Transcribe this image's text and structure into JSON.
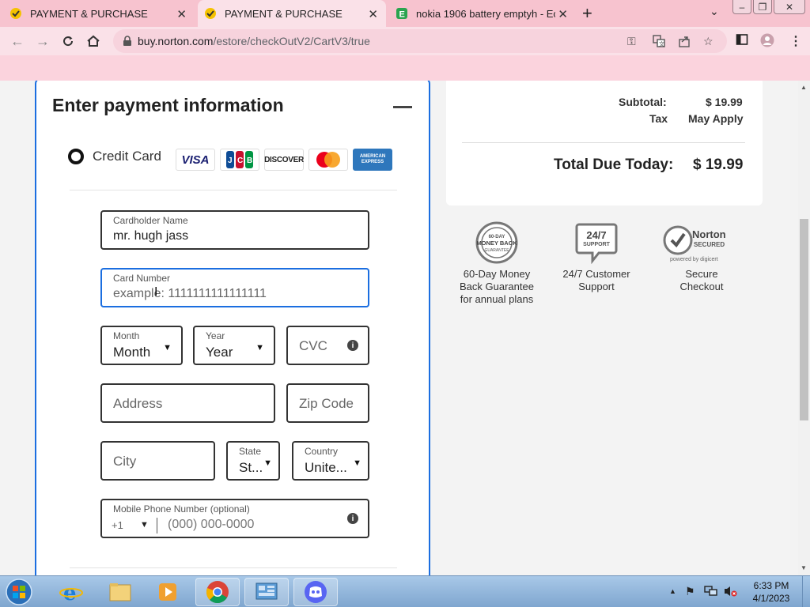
{
  "browser": {
    "tabs": [
      {
        "title": "PAYMENT & PURCHASE",
        "active": false
      },
      {
        "title": "PAYMENT & PURCHASE",
        "active": true
      },
      {
        "title": "nokia 1906 battery emptyh - Eco",
        "active": false
      }
    ],
    "url_host": "buy.norton.com",
    "url_path": "/estore/checkOutV2/CartV3/true"
  },
  "payment": {
    "title": "Enter payment information",
    "method_label": "Credit Card",
    "card_brands": [
      "VISA",
      "JCB",
      "DISCOVER",
      "Mastercard",
      "AMERICAN EXPRESS"
    ],
    "cardholder": {
      "label": "Cardholder Name",
      "value": "mr. hugh jass"
    },
    "card_number": {
      "label": "Card Number",
      "placeholder": "example: 1111111111111111"
    },
    "month": {
      "label": "Month",
      "value": "Month"
    },
    "year": {
      "label": "Year",
      "value": "Year"
    },
    "cvc": {
      "placeholder": "CVC"
    },
    "address": {
      "placeholder": "Address"
    },
    "zip": {
      "placeholder": "Zip Code"
    },
    "city": {
      "placeholder": "City"
    },
    "state": {
      "label": "State",
      "value": "St..."
    },
    "country": {
      "label": "Country",
      "value": "Unite..."
    },
    "phone": {
      "label": "Mobile Phone Number (optional)",
      "prefix": "+1",
      "placeholder": "(000) 000-0000"
    }
  },
  "summary": {
    "subtotal_label": "Subtotal:",
    "subtotal_value": "$ 19.99",
    "tax_label": "Tax",
    "tax_value": "May Apply",
    "total_label": "Total Due Today:",
    "total_value": "$ 19.99"
  },
  "badges": [
    {
      "seal_text": "60-DAY MONEY BACK GUARANTEE",
      "caption_lines": [
        "60-Day Money",
        "Back Guarantee",
        "for annual plans"
      ]
    },
    {
      "seal_text": "24/7 SUPPORT",
      "caption_lines": [
        "24/7 Customer",
        "Support"
      ]
    },
    {
      "seal_text": "Norton SECURED powered by digicert",
      "caption_lines": [
        "Secure",
        "Checkout"
      ]
    }
  ],
  "taskbar": {
    "time": "6:33 PM",
    "date": "4/1/2023"
  },
  "colors": {
    "accent": "#1b6ee0",
    "tabstrip": "#f7c3cf",
    "toolbar": "#fae1e8"
  }
}
